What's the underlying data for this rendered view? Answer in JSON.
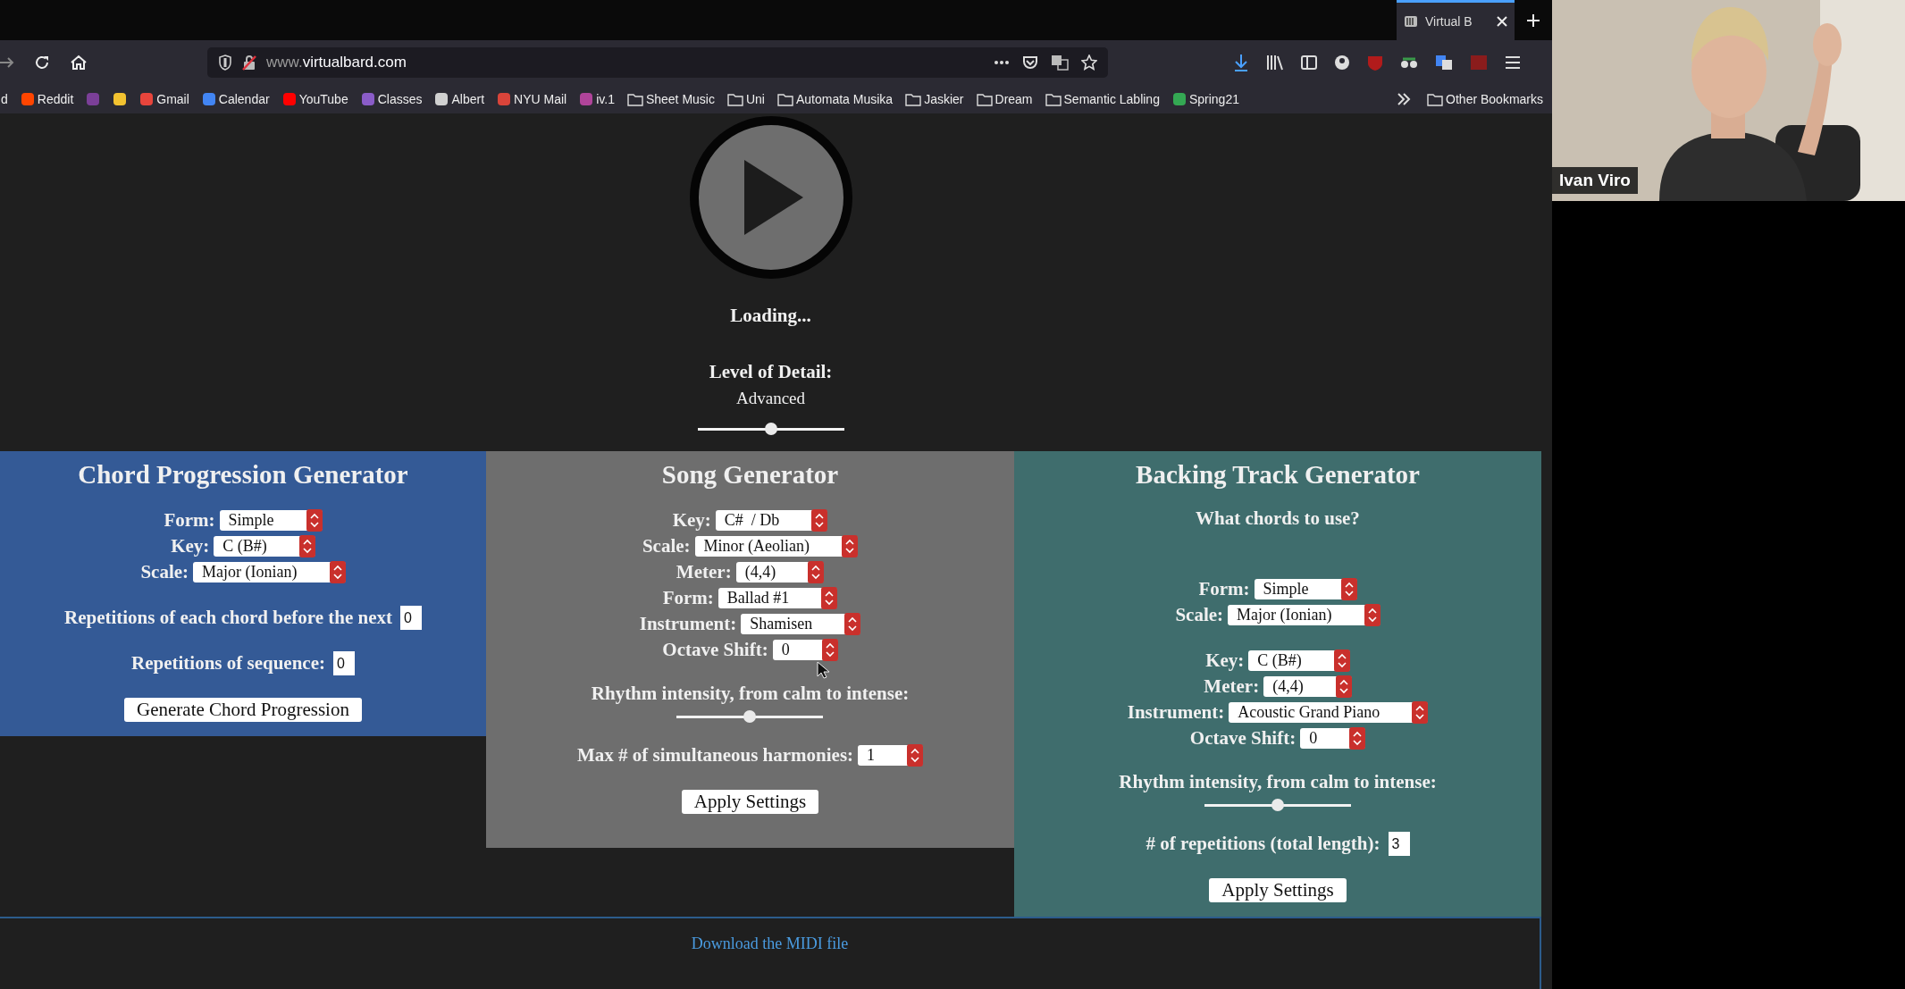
{
  "browser": {
    "tab": {
      "title": "Virtual B",
      "selected": true
    },
    "url_prefix": "www.",
    "url_domain": "virtualbard.com",
    "bookmarks": [
      {
        "kind": "text",
        "label": "d"
      },
      {
        "kind": "site",
        "label": "Reddit",
        "color": "#ff4500"
      },
      {
        "kind": "site",
        "color": "#7b3f98"
      },
      {
        "kind": "site",
        "color": "#f2c230"
      },
      {
        "kind": "site",
        "label": "Gmail",
        "color": "#e8453c"
      },
      {
        "kind": "site",
        "label": "Calendar",
        "color": "#4285f4"
      },
      {
        "kind": "site",
        "label": "YouTube",
        "color": "#ff0000"
      },
      {
        "kind": "site",
        "label": "Classes",
        "color": "#8a5cc8"
      },
      {
        "kind": "site",
        "label": "Albert",
        "color": "#d0d0d0"
      },
      {
        "kind": "site",
        "label": "NYU Mail",
        "color": "#d9443a"
      },
      {
        "kind": "site",
        "label": "iv.1",
        "color": "#b0449a"
      },
      {
        "kind": "folder",
        "label": "Sheet Music"
      },
      {
        "kind": "folder",
        "label": "Uni"
      },
      {
        "kind": "folder",
        "label": "Automata Musika"
      },
      {
        "kind": "folder",
        "label": "Jaskier"
      },
      {
        "kind": "folder",
        "label": "Dream"
      },
      {
        "kind": "folder",
        "label": "Semantic Labling"
      },
      {
        "kind": "site",
        "label": "Spring21",
        "color": "#34a853"
      }
    ],
    "other_bookmarks": "Other Bookmarks"
  },
  "page": {
    "loading": "Loading...",
    "detail_label": "Level of Detail:",
    "detail_value": "Advanced",
    "detail_slider": {
      "level": 0.5
    },
    "panels": [
      {
        "title": "Chord Progression Generator",
        "color": "#345a96",
        "groups": [
          [
            {
              "kind": "select",
              "label": "Form:",
              "value": "Simple"
            },
            {
              "kind": "select",
              "label": "Key:",
              "value": "C (B#)"
            },
            {
              "kind": "select",
              "label": "Scale:",
              "value": "Major (Ionian)"
            }
          ],
          [
            {
              "kind": "number",
              "label": "Repetitions of each chord before the next",
              "value": "0"
            }
          ],
          [
            {
              "kind": "number",
              "label": "Repetitions of sequence:",
              "value": "0"
            }
          ],
          [
            {
              "kind": "button",
              "label": "Generate Chord Progression"
            }
          ]
        ]
      },
      {
        "title": "Song Generator",
        "color": "#6e6e6e",
        "groups": [
          [
            {
              "kind": "select",
              "label": "Key:",
              "value": "C#  / Db"
            },
            {
              "kind": "select",
              "label": "Scale:",
              "value": "Minor (Aeolian)"
            },
            {
              "kind": "select",
              "label": "Meter:",
              "value": "(4,4)"
            },
            {
              "kind": "select",
              "label": "Form:",
              "value": "Ballad #1"
            },
            {
              "kind": "select",
              "label": "Instrument:",
              "value": "Shamisen"
            },
            {
              "kind": "select",
              "label": "Octave Shift:",
              "value": "0"
            }
          ],
          [
            {
              "kind": "slider",
              "label": "Rhythm intensity, from calm to intense:",
              "level": 0.5
            }
          ],
          [
            {
              "kind": "select",
              "label": "Max # of simultaneous harmonies:",
              "value": "1"
            }
          ],
          [
            {
              "kind": "button",
              "label": "Apply Settings"
            }
          ]
        ]
      },
      {
        "title": "Backing Track Generator",
        "color": "#3f6d6d",
        "groups": [
          [
            {
              "kind": "text",
              "label": "What chords to use?"
            }
          ],
          [
            {
              "kind": "select",
              "label": "Form:",
              "value": "Simple"
            },
            {
              "kind": "select",
              "label": "Scale:",
              "value": "Major (Ionian)"
            }
          ],
          [
            {
              "kind": "select",
              "label": "Key:",
              "value": "C (B#)"
            },
            {
              "kind": "select",
              "label": "Meter:",
              "value": "(4,4)"
            },
            {
              "kind": "select",
              "label": "Instrument:",
              "value": "Acoustic Grand Piano"
            },
            {
              "kind": "select",
              "label": "Octave Shift:",
              "value": "0"
            }
          ],
          [
            {
              "kind": "slider",
              "label": "Rhythm intensity, from calm to intense:",
              "level": 0.5
            }
          ],
          [
            {
              "kind": "number",
              "label": "# of repetitions (total length):",
              "value": "3"
            }
          ],
          [
            {
              "kind": "button",
              "label": "Apply Settings"
            }
          ]
        ]
      }
    ],
    "download_link": "Download the MIDI file"
  },
  "video": {
    "name": "Ivan Viro"
  }
}
